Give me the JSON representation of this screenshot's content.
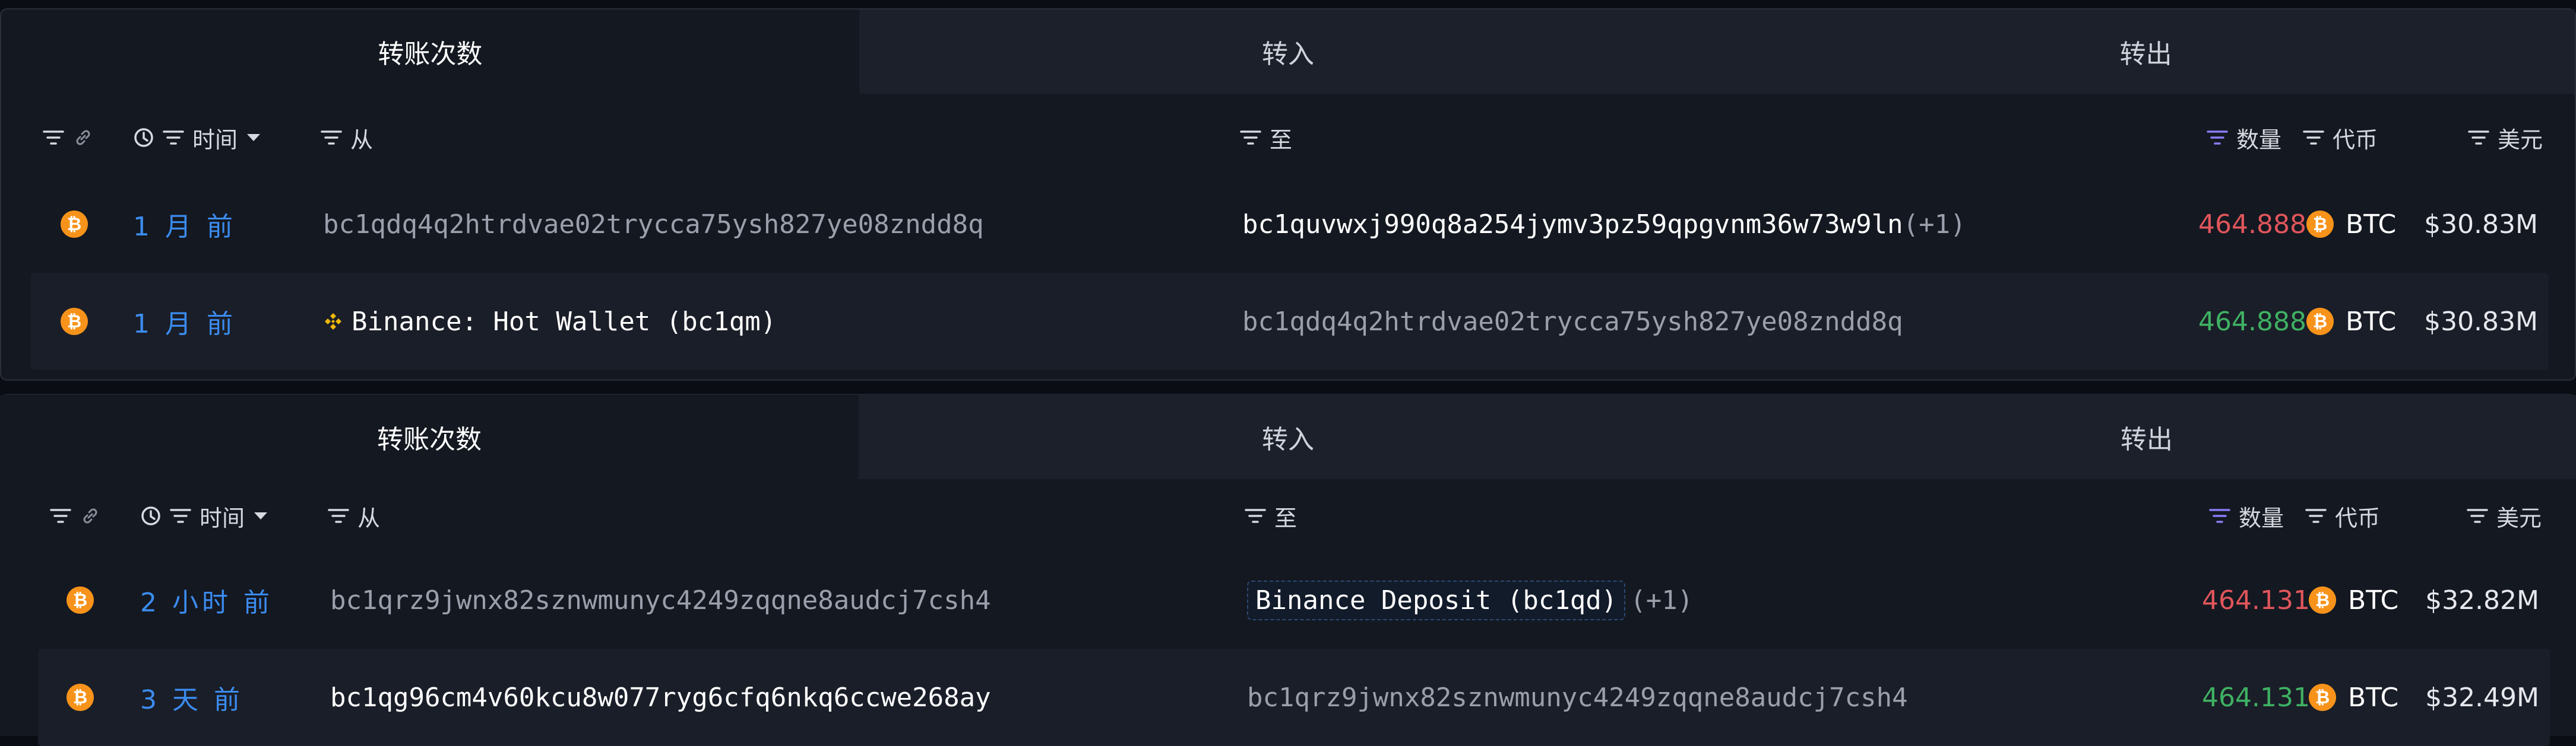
{
  "colors": {
    "bg": "#0b0d14",
    "panel": "#141821",
    "time_link": "#3b8cf0",
    "amount_out": "#e0565b",
    "amount_in": "#3fb163",
    "btc": "#f7931a",
    "binance": "#f0b90b",
    "sort_active": "#8a7cf5"
  },
  "panels": [
    {
      "tabs": [
        "转账次数",
        "转入",
        "转出"
      ],
      "headers": {
        "time": "时间",
        "from": "从",
        "to": "至",
        "amount": "数量",
        "token": "代币",
        "usd": "美元"
      },
      "rows": [
        {
          "icon": "btc",
          "time": "1 月 前",
          "from": "bc1qdq4q2htrdvae02trycca75ysh827ye08zndd8q",
          "to": "bc1quvwxj990q8a254jymv3pz59qpgvnm36w73w9ln",
          "to_extra": "(+1)",
          "amount": "464.888",
          "direction": "out",
          "token": "BTC",
          "usd": "$30.83M"
        },
        {
          "icon": "btc",
          "time": "1 月 前",
          "from": "Binance: Hot Wallet (bc1qm)",
          "from_icon": "binance",
          "to": "bc1qdq4q2htrdvae02trycca75ysh827ye08zndd8q",
          "amount": "464.888",
          "direction": "in",
          "token": "BTC",
          "usd": "$30.83M"
        }
      ]
    },
    {
      "tabs": [
        "转账次数",
        "转入",
        "转出"
      ],
      "headers": {
        "time": "时间",
        "from": "从",
        "to": "至",
        "amount": "数量",
        "token": "代币",
        "usd": "美元"
      },
      "rows": [
        {
          "icon": "btc",
          "time": "2 小时 前",
          "from": "bc1qrz9jwnx82sznwmunyc4249zqqne8audcj7csh4",
          "to": "Binance Deposit (bc1qd)",
          "to_extra": "(+1)",
          "amount": "464.131",
          "direction": "out",
          "token": "BTC",
          "usd": "$32.82M"
        },
        {
          "icon": "btc",
          "time": "3 天 前",
          "from": "bc1qg96cm4v60kcu8w077ryg6cfq6nkq6ccwe268ay",
          "to": "bc1qrz9jwnx82sznwmunyc4249zqqne8audcj7csh4",
          "amount": "464.131",
          "direction": "in",
          "token": "BTC",
          "usd": "$32.49M"
        }
      ]
    }
  ]
}
